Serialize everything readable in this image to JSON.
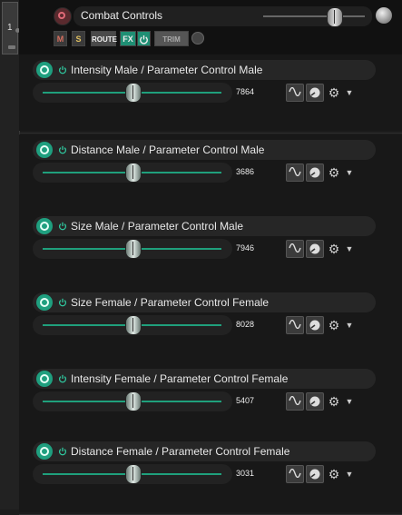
{
  "track": {
    "number": "1",
    "name": "Combat Controls",
    "buttons": {
      "mute": "M",
      "solo": "S",
      "route": "ROUTE",
      "fx": "FX",
      "trim": "TRIM"
    }
  },
  "icons": {
    "record_arm": "record-arm-icon",
    "power": "power-icon",
    "sine": "sine-icon",
    "knob": "knob-icon",
    "gear": "gear-icon",
    "dropdown": "dropdown-arrow-icon"
  },
  "colors": {
    "accent": "#1f9f7f",
    "background": "#1c1c1c",
    "mute": "#d87060",
    "solo": "#e0c060"
  },
  "lanes": [
    {
      "title": "Intensity Male / Parameter Control Male",
      "value": "7864"
    },
    {
      "title": "Distance Male / Parameter Control Male",
      "value": "3686"
    },
    {
      "title": "Size Male / Parameter Control Male",
      "value": "7946"
    },
    {
      "title": "Size Female / Parameter Control Female",
      "value": "8028"
    },
    {
      "title": "Intensity Female / Parameter Control Female",
      "value": "5407"
    },
    {
      "title": "Distance Female / Parameter Control Female",
      "value": "3031"
    }
  ]
}
